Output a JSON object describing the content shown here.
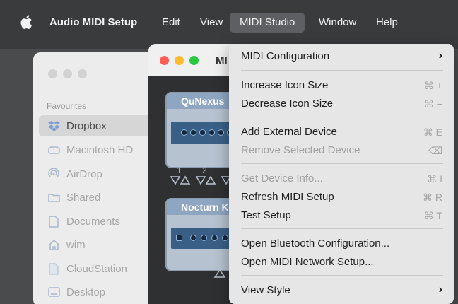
{
  "menubar": {
    "app_name": "Audio MIDI Setup",
    "items": [
      "Edit",
      "View",
      "MIDI Studio",
      "Window",
      "Help"
    ]
  },
  "finder": {
    "section_heading": "Favourites",
    "items": [
      {
        "label": "Dropbox",
        "icon": "dropbox-icon",
        "selected": true
      },
      {
        "label": "Macintosh HD",
        "icon": "drive-icon"
      },
      {
        "label": "AirDrop",
        "icon": "airdrop-icon"
      },
      {
        "label": "Shared",
        "icon": "folder-icon"
      },
      {
        "label": "Documents",
        "icon": "document-icon"
      },
      {
        "label": "wim",
        "icon": "home-icon"
      },
      {
        "label": "CloudStation",
        "icon": "document-icon"
      },
      {
        "label": "Desktop",
        "icon": "desktop-icon"
      }
    ]
  },
  "studio": {
    "title_partial": "MI",
    "devices": [
      {
        "name": "QuNexus",
        "ports": [
          "1",
          "2"
        ]
      },
      {
        "name": "Nocturn Ke"
      }
    ]
  },
  "menu": {
    "items": [
      {
        "label": "MIDI Configuration",
        "submenu": true
      },
      {
        "label": "Increase Icon Size",
        "shortcut": "⌘ +"
      },
      {
        "label": "Decrease Icon Size",
        "shortcut": "⌘ −"
      },
      {
        "label": "Add External Device",
        "shortcut": "⌘ E"
      },
      {
        "label": "Remove Selected Device",
        "disabled": true,
        "shortcut": "⌫"
      },
      {
        "label": "Get Device Info...",
        "disabled": true,
        "shortcut": "⌘ I"
      },
      {
        "label": "Refresh MIDI Setup",
        "shortcut": "⌘ R"
      },
      {
        "label": "Test Setup",
        "shortcut": "⌘ T"
      },
      {
        "label": "Open Bluetooth Configuration..."
      },
      {
        "label": "Open MIDI Network Setup..."
      },
      {
        "label": "View Style",
        "submenu": true
      }
    ],
    "submenu_arrow": "›"
  },
  "colors": {
    "menubar": "#3a3b3d",
    "menu_bg": "#e6e6e6",
    "traffic_close": "#ff5f57",
    "traffic_min": "#febc2e",
    "traffic_max": "#28c840"
  }
}
